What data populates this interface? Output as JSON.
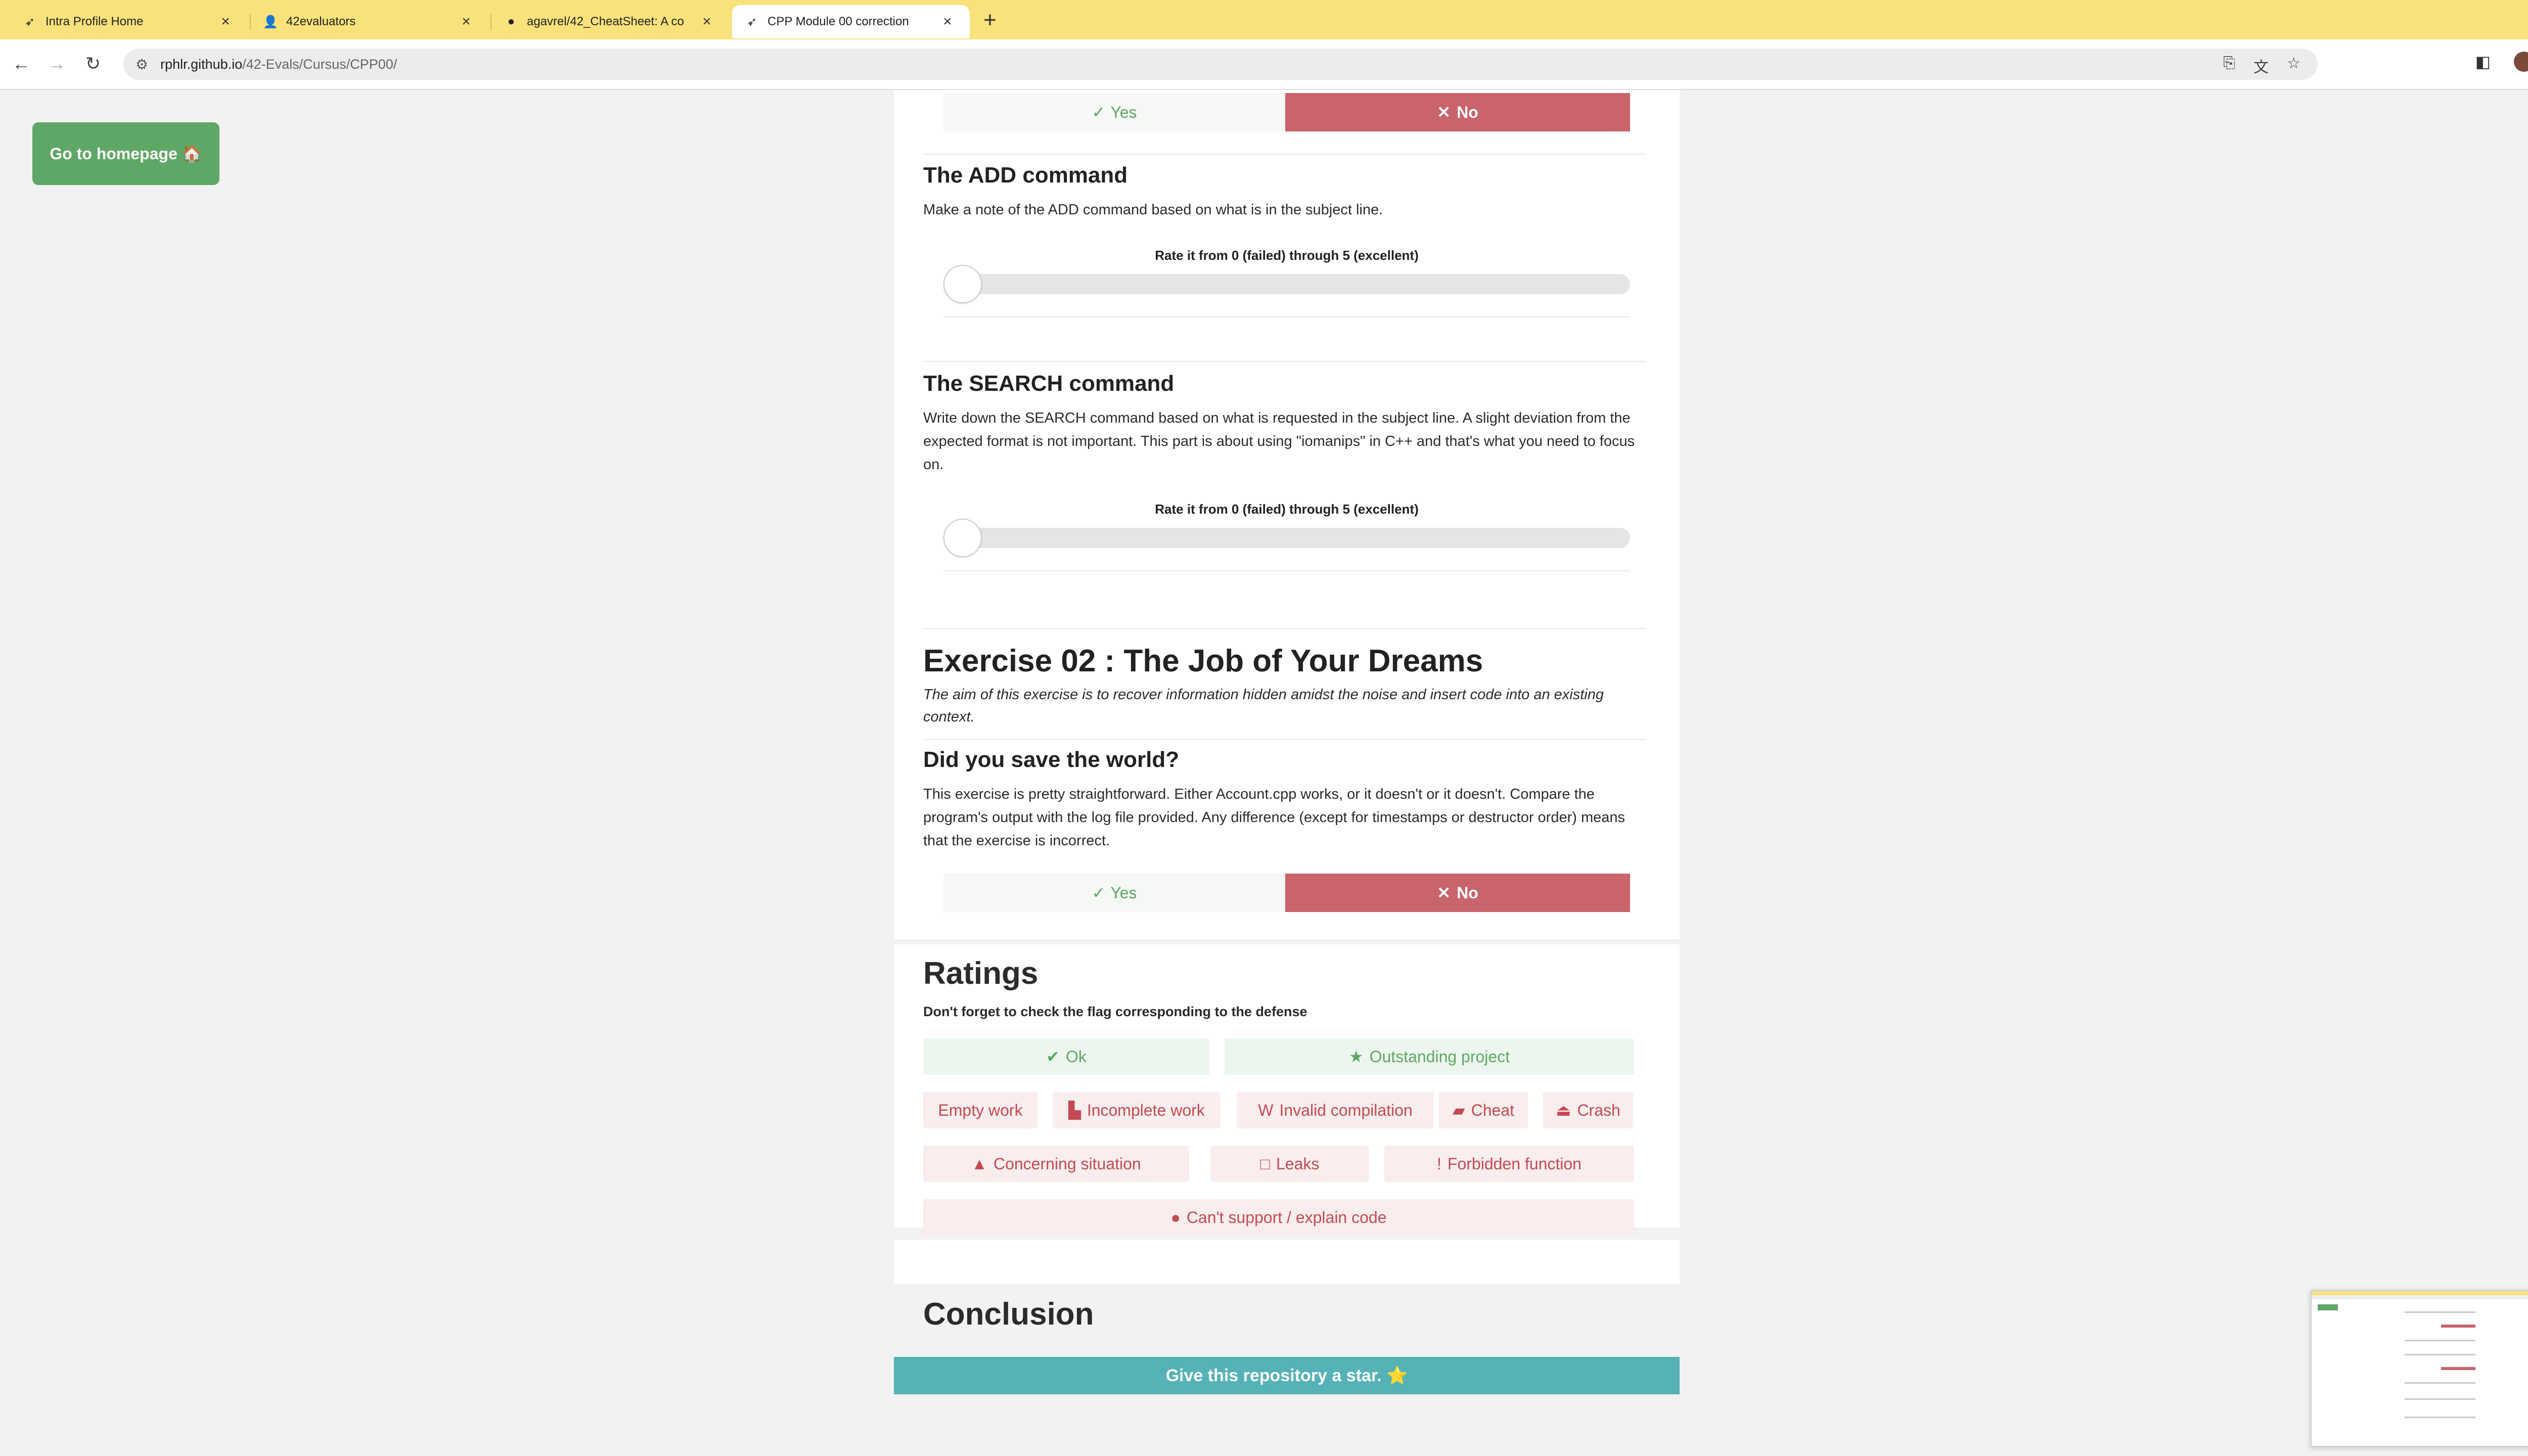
{
  "browser": {
    "tabs": [
      {
        "title": "Intra Profile Home",
        "icon": "42-logo-icon",
        "active": false
      },
      {
        "title": "42evaluators",
        "icon": "evaluator-icon",
        "active": false
      },
      {
        "title": "agavrel/42_CheatSheet: A co",
        "icon": "github-icon",
        "active": false
      },
      {
        "title": "CPP Module 00 correction",
        "icon": "42-logo-icon",
        "active": true
      }
    ],
    "url_host": "rphlr.github.io",
    "url_path": "/42-Evals/Cursus/CPP00/"
  },
  "page": {
    "home_button": "Go to homepage 🏠",
    "yes_label": "Yes",
    "no_label": "No",
    "rate_label": "Rate it from 0 (failed) through 5 (excellent)",
    "add": {
      "title": "The ADD command",
      "text": "Make a note of the ADD command based on what is in the subject line.",
      "rating": 0
    },
    "search": {
      "title": "The SEARCH command",
      "text": "Write down the SEARCH command based on what is requested in the subject line. A slight deviation from the expected format is not important. This part is about using \"iomanips\" in C++ and that's what you need to focus on.",
      "rating": 0
    },
    "exercise02": {
      "title": "Exercise 02 : The Job of Your Dreams",
      "aim": "The aim of this exercise is to recover information hidden amidst the noise and insert code into an existing context.",
      "question": "Did you save the world?",
      "text": "This exercise is pretty straightforward. Either Account.cpp works, or it doesn't or it doesn't. Compare the program's output with the log file provided. Any difference (except for timestamps or destructor order) means that the exercise is incorrect."
    },
    "ratings": {
      "title": "Ratings",
      "subtitle": "Don't forget to check the flag corresponding to the defense",
      "flags": {
        "ok": "Ok",
        "outstanding": "Outstanding project",
        "empty": "Empty work",
        "incomplete": "Incomplete work",
        "invalid": "Invalid compilation",
        "cheat": "Cheat",
        "crash": "Crash",
        "concerning": "Concerning situation",
        "leaks": "Leaks",
        "forbidden": "Forbidden function",
        "cant_support": "Can't support / explain code"
      }
    },
    "conclusion": "Conclusion",
    "star_bar": "Give this repository a star. ⭐"
  },
  "colors": {
    "tabbar": "#f9e27c",
    "green": "#5fa766",
    "red": "#c9636c",
    "teal": "#55b2b6"
  }
}
